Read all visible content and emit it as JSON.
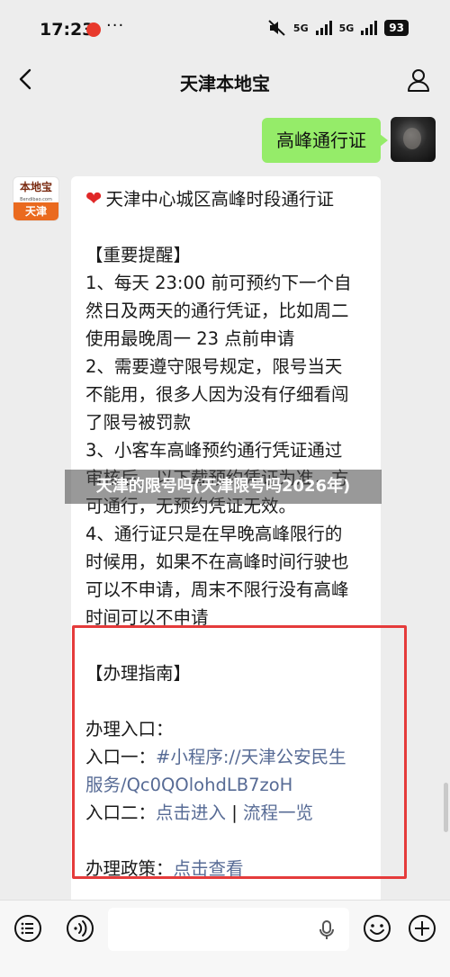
{
  "status_bar": {
    "time": "17:23",
    "notification_badge": "",
    "overflow": "···",
    "network_1": "5G",
    "network_2": "5G",
    "battery": "93"
  },
  "header": {
    "title": "天津本地宝"
  },
  "outgoing": {
    "text": "高峰通行证"
  },
  "sender": {
    "logo_top": "本地宝",
    "logo_sub": "Bendibao.com",
    "logo_bottom": "天津"
  },
  "message": {
    "title": "天津中心城区高峰时段通行证",
    "reminder_heading": "【重要提醒】",
    "reminder_lines": [
      "1、每天 23:00 前可预约下一个自",
      "然日及两天的通行凭证，比如周二",
      "使用最晚周一 23 点前申请",
      "2、需要遵守限号规定，限号当天",
      "不能用，很多人因为没有仔细看闯",
      "了限号被罚款",
      "3、小客车高峰预约通行凭证通过",
      "审核后，以下载预约凭证为准，方",
      "可通行，无预约凭证无效。",
      "4、通行证只是在早晚高峰限行的",
      "时候用，如果不在高峰时间行驶也",
      "可以不申请，周末不限行没有高峰",
      "时间可以不申请"
    ],
    "guide_heading": "【办理指南】",
    "entry_heading": "办理入口：",
    "entry1_label": "入口一：",
    "entry1_link_line1": "#小程序://天津公安民生",
    "entry1_link_line2": "服务/Qc0QOlohdLB7zoH",
    "entry2_label": "入口二：",
    "entry2_link_a": "点击进入",
    "entry2_separator": " | ",
    "entry2_link_b": "流程一览",
    "policy_label": "办理政策：",
    "policy_link": "点击查看"
  },
  "watermark": "天津的限号吗(天津限号吗2026年)",
  "colors": {
    "bubble_green": "#95ec69",
    "link_blue": "#576b95",
    "highlight_red": "#e53b3b",
    "heart_red": "#e02828"
  },
  "icons": [
    "back-arrow-icon",
    "person-icon",
    "voice-toggle-icon",
    "list-icon",
    "microphone-icon",
    "emoji-icon",
    "plus-icon",
    "heart-icon"
  ]
}
